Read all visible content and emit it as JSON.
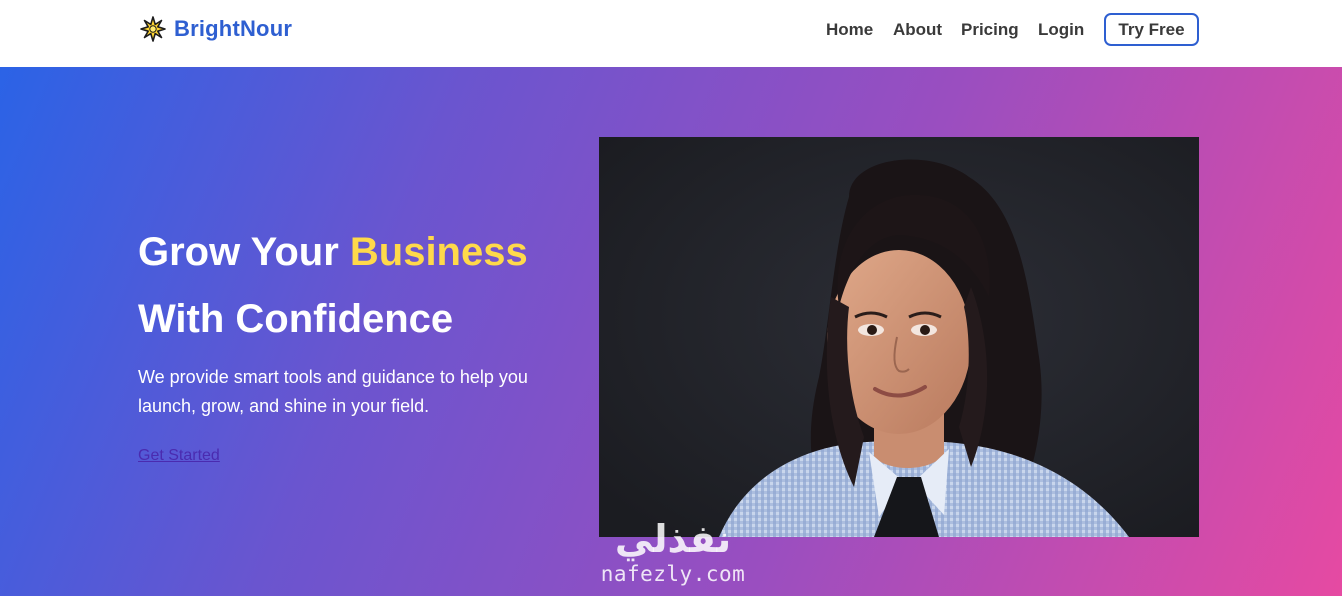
{
  "brand": {
    "name": "BrightNour",
    "logo_icon": "star-burst-icon",
    "color": "#2e5fd1"
  },
  "nav": {
    "items": [
      {
        "label": "Home"
      },
      {
        "label": "About"
      },
      {
        "label": "Pricing"
      },
      {
        "label": "Login"
      }
    ],
    "cta_label": "Try Free"
  },
  "hero": {
    "title_line1_prefix": "Grow Your ",
    "title_line1_accent": "Business",
    "title_line2": "With Confidence",
    "description": "We provide smart tools and guidance to help you launch, grow, and shine in your field.",
    "cta_label": "Get Started",
    "accent_color": "#ffd94a",
    "gradient": [
      "#2b63e6",
      "#9a4ec0",
      "#e64aa2"
    ]
  },
  "watermark": {
    "arabic": "نفذلي",
    "latin": "nafezly.com"
  }
}
